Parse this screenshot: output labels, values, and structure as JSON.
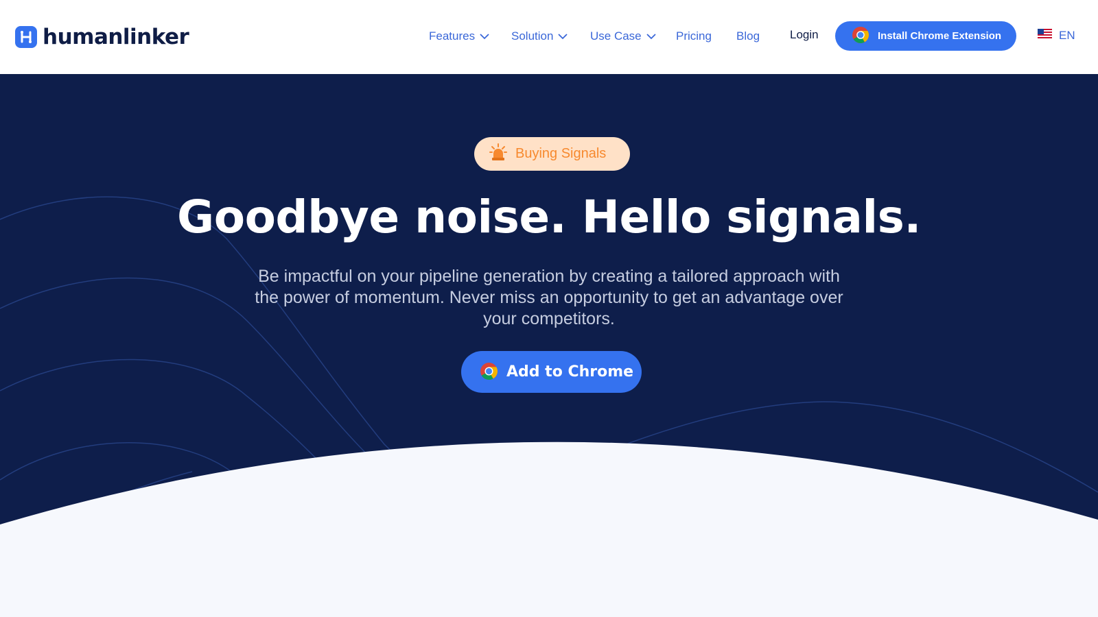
{
  "header": {
    "logo_text": "humanlinker",
    "nav": [
      {
        "label": "Features",
        "dropdown": true
      },
      {
        "label": "Solution",
        "dropdown": true
      },
      {
        "label": "Use Case",
        "dropdown": true
      },
      {
        "label": "Pricing",
        "dropdown": false
      },
      {
        "label": "Blog",
        "dropdown": false
      }
    ],
    "login_label": "Login",
    "install_label": "Install Chrome Extension",
    "language": "EN"
  },
  "hero": {
    "badge_label": "Buying Signals",
    "title": "Goodbye noise. Hello signals.",
    "subtitle": "Be impactful on your pipeline generation by creating a tailored approach with the power of momentum. Never miss an opportunity to get an advantage over your competitors.",
    "cta_label": "Add to Chrome"
  },
  "colors": {
    "brand_blue": "#3572ef",
    "hero_bg": "#0e1e4b",
    "nav_text": "#3a67d8",
    "badge_bg": "#ffe1c7",
    "badge_text": "#f7892e",
    "page_bg": "#f6f8fd"
  },
  "icons": {
    "logo": "humanlinker-logo-icon",
    "dropdown": "chevron-down-icon",
    "chrome": "chrome-icon",
    "badge": "siren-icon",
    "flag": "us-flag-icon"
  }
}
